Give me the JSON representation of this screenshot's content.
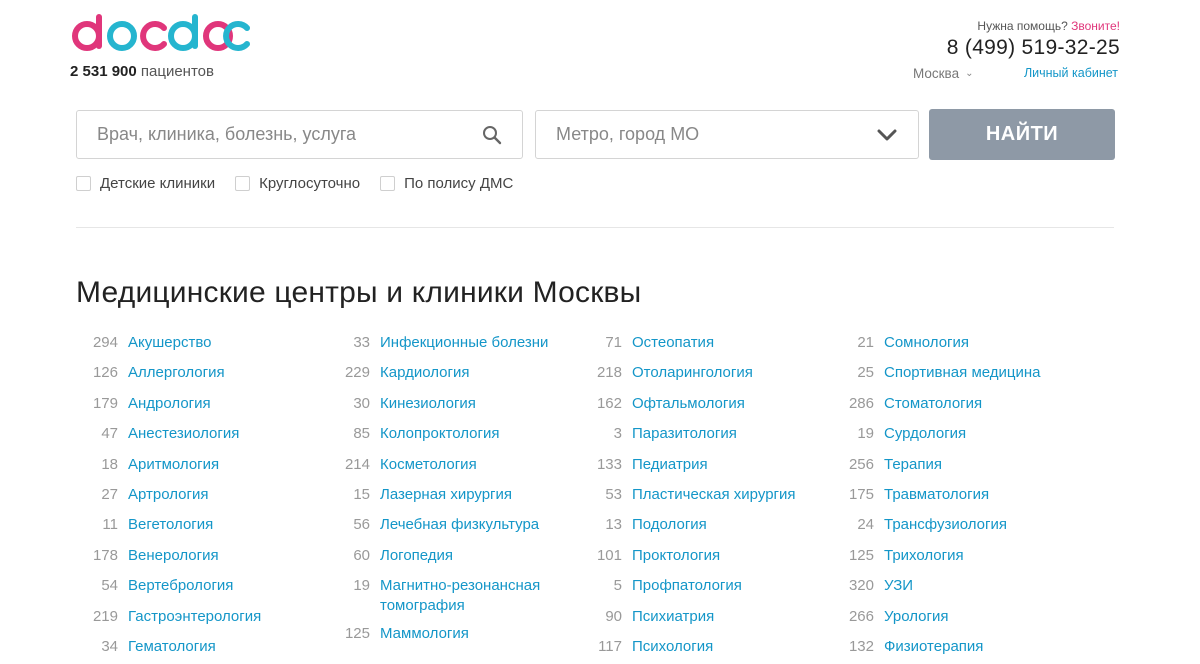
{
  "brand": {
    "logo_text": "docdoc",
    "patients_count": "2 531 900",
    "patients_label": "пациентов",
    "colors": {
      "pink": "#e0367b",
      "teal": "#25b5cf",
      "link": "#1496c8",
      "button": "#8e99a6"
    }
  },
  "header": {
    "help_text": "Нужна помощь?",
    "help_link": "Звоните!",
    "phone": "8 (499) 519-32-25",
    "city": "Москва",
    "cabinet": "Личный кабинет"
  },
  "search": {
    "query_placeholder": "Врач, клиника, болезнь, услуга",
    "metro_placeholder": "Метро, город МО",
    "button_label": "НАЙТИ",
    "filters": [
      "Детские клиники",
      "Круглосуточно",
      "По полису ДМС"
    ]
  },
  "page_title": "Медицинские центры и клиники Москвы",
  "columns": [
    [
      {
        "count": "294",
        "name": "Акушерство"
      },
      {
        "count": "126",
        "name": "Аллергология"
      },
      {
        "count": "179",
        "name": "Андрология"
      },
      {
        "count": "47",
        "name": "Анестезиология"
      },
      {
        "count": "18",
        "name": "Аритмология"
      },
      {
        "count": "27",
        "name": "Артрология"
      },
      {
        "count": "11",
        "name": "Вегетология"
      },
      {
        "count": "178",
        "name": "Венерология"
      },
      {
        "count": "54",
        "name": "Вертебрология"
      },
      {
        "count": "219",
        "name": "Гастроэнтерология"
      },
      {
        "count": "34",
        "name": "Гематология"
      }
    ],
    [
      {
        "count": "33",
        "name": "Инфекционные болезни"
      },
      {
        "count": "229",
        "name": "Кардиология"
      },
      {
        "count": "30",
        "name": "Кинезиология"
      },
      {
        "count": "85",
        "name": "Колопроктология"
      },
      {
        "count": "214",
        "name": "Косметология"
      },
      {
        "count": "15",
        "name": "Лазерная хирургия"
      },
      {
        "count": "56",
        "name": "Лечебная физкультура"
      },
      {
        "count": "60",
        "name": "Логопедия"
      },
      {
        "count": "19",
        "name": "Магнитно-резонансная томография"
      },
      {
        "count": "125",
        "name": "Маммология"
      }
    ],
    [
      {
        "count": "71",
        "name": "Остеопатия"
      },
      {
        "count": "218",
        "name": "Отоларингология"
      },
      {
        "count": "162",
        "name": "Офтальмология"
      },
      {
        "count": "3",
        "name": "Паразитология"
      },
      {
        "count": "133",
        "name": "Педиатрия"
      },
      {
        "count": "53",
        "name": "Пластическая хирургия"
      },
      {
        "count": "13",
        "name": "Подология"
      },
      {
        "count": "101",
        "name": "Проктология"
      },
      {
        "count": "5",
        "name": "Профпатология"
      },
      {
        "count": "90",
        "name": "Психиатрия"
      },
      {
        "count": "117",
        "name": "Психология"
      }
    ],
    [
      {
        "count": "21",
        "name": "Сомнология"
      },
      {
        "count": "25",
        "name": "Спортивная медицина"
      },
      {
        "count": "286",
        "name": "Стоматология"
      },
      {
        "count": "19",
        "name": "Сурдология"
      },
      {
        "count": "256",
        "name": "Терапия"
      },
      {
        "count": "175",
        "name": "Травматология"
      },
      {
        "count": "24",
        "name": "Трансфузиология"
      },
      {
        "count": "125",
        "name": "Трихология"
      },
      {
        "count": "320",
        "name": "УЗИ"
      },
      {
        "count": "266",
        "name": "Урология"
      },
      {
        "count": "132",
        "name": "Физиотерапия"
      }
    ]
  ]
}
